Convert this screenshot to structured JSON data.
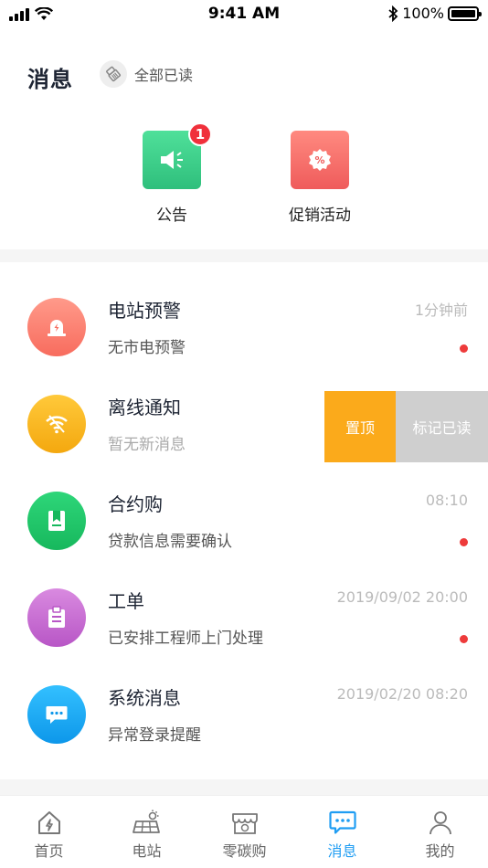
{
  "status_bar": {
    "time": "9:41 AM",
    "battery": "100%",
    "battery_level": 1.0
  },
  "header": {
    "title": "消息",
    "mark_all_read": "全部已读"
  },
  "quick_entries": [
    {
      "label": "公告",
      "badge": "1",
      "icon": "megaphone-icon",
      "color": "#3ecf8e"
    },
    {
      "label": "促销活动",
      "icon": "discount-icon",
      "color": "#f26a6a"
    }
  ],
  "messages": [
    {
      "title": "电站预警",
      "subtitle": "无市电预警",
      "time": "1分钟前",
      "unread": true,
      "icon": "alert-icon",
      "color": "#fb7a6a"
    },
    {
      "title": "离线通知",
      "subtitle": "暂无新消息",
      "time": "",
      "unread": false,
      "icon": "wifi-icon",
      "color": "#f9b51c"
    },
    {
      "title": "合约购",
      "subtitle": "贷款信息需要确认",
      "time": "08:10",
      "unread": true,
      "icon": "contract-icon",
      "color": "#21c66a"
    },
    {
      "title": "工单",
      "subtitle": "已安排工程师上门处理",
      "time": "2019/09/02 20:00",
      "unread": true,
      "icon": "clipboard-icon",
      "color": "#c86ad3"
    },
    {
      "title": "系统消息",
      "subtitle": "异常登录提醒",
      "time": "2019/02/20 08:20",
      "unread": false,
      "icon": "chat-icon",
      "color": "#1ba9f5"
    }
  ],
  "swipe_actions": {
    "pin": "置顶",
    "mark_read": "标记已读"
  },
  "tabs": [
    {
      "label": "首页",
      "icon": "home-icon",
      "active": false
    },
    {
      "label": "电站",
      "icon": "solar-panel-icon",
      "active": false
    },
    {
      "label": "零碳购",
      "icon": "shop-icon",
      "active": false
    },
    {
      "label": "消息",
      "icon": "message-icon",
      "active": true
    },
    {
      "label": "我的",
      "icon": "profile-icon",
      "active": false
    }
  ],
  "colors": {
    "accent": "#1f9df3",
    "unread_dot": "#ee3b3b"
  }
}
